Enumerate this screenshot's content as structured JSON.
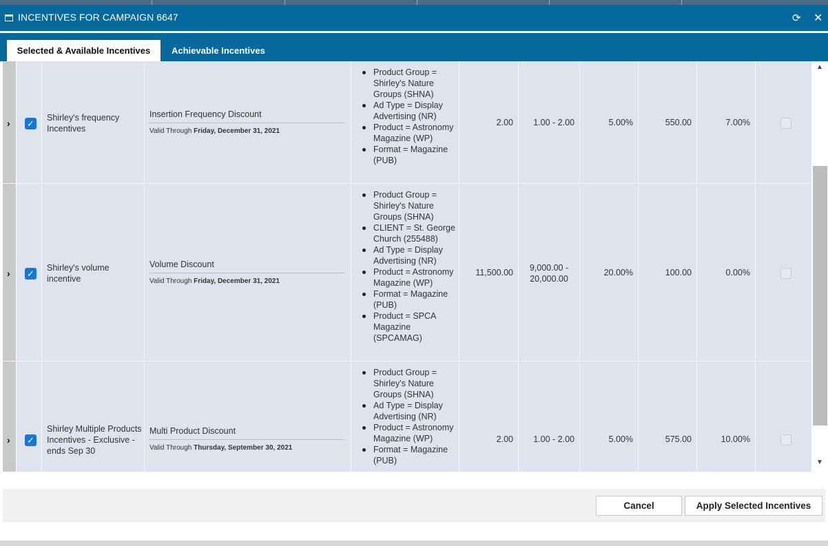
{
  "dialog": {
    "title": "INCENTIVES FOR CAMPAIGN 6647",
    "refresh_icon": "refresh-icon",
    "close_icon": "close-icon"
  },
  "tabs": [
    {
      "label": "Selected & Available Incentives",
      "active": true
    },
    {
      "label": "Achievable Incentives",
      "active": false
    }
  ],
  "rows": [
    {
      "checked": true,
      "name": "Shirley's frequency Incentives",
      "type": "Insertion Frequency Discount",
      "valid_prefix": "Valid Through",
      "valid_date": "Friday, December 31, 2021",
      "criteria": [
        "Product Group = Shirley's Nature Groups (SHNA)",
        "Ad Type = Display Advertising (NR)",
        "Product = Astronomy Magazine (WP)",
        "Format = Magazine (PUB)"
      ],
      "actual": "2.00",
      "range": "1.00 - 2.00",
      "percent": "5.00%",
      "amount": "550.00",
      "percent2": "7.00%"
    },
    {
      "checked": true,
      "name": "Shirley's volume incentive",
      "type": "Volume Discount",
      "valid_prefix": "Valid Through",
      "valid_date": "Friday, December 31, 2021",
      "criteria": [
        "Product Group = Shirley's Nature Groups (SHNA)",
        "CLIENT = St. George Church (255488)",
        "Ad Type = Display Advertising (NR)",
        "Product = Astronomy Magazine (WP)",
        "Format = Magazine (PUB)",
        "Product = SPCA Magazine (SPCAMAG)"
      ],
      "actual": "11,500.00",
      "range_line1": "9,000.00 -",
      "range_line2": "20,000.00",
      "percent": "20.00%",
      "amount": "100.00",
      "percent2": "0.00%"
    },
    {
      "checked": true,
      "name": "Shirley Multiple Products Incentives - Exclusive - ends Sep 30",
      "type": "Multi Product Discount",
      "valid_prefix": "Valid Through",
      "valid_date": "Thursday, September 30, 2021",
      "criteria": [
        "Product Group = Shirley's Nature Groups (SHNA)",
        "Ad Type = Display Advertising (NR)",
        "Product = Astronomy Magazine (WP)",
        "Format = Magazine (PUB)"
      ],
      "actual": "2.00",
      "range": "1.00 - 2.00",
      "percent": "5.00%",
      "amount": "575.00",
      "percent2": "10.00%"
    }
  ],
  "footer": {
    "cancel_label": "Cancel",
    "apply_label": "Apply Selected Incentives"
  },
  "colors": {
    "header_blue": "#05699c",
    "grid_bg": "#dfe3ee",
    "checkbox_blue": "#1677d8"
  }
}
